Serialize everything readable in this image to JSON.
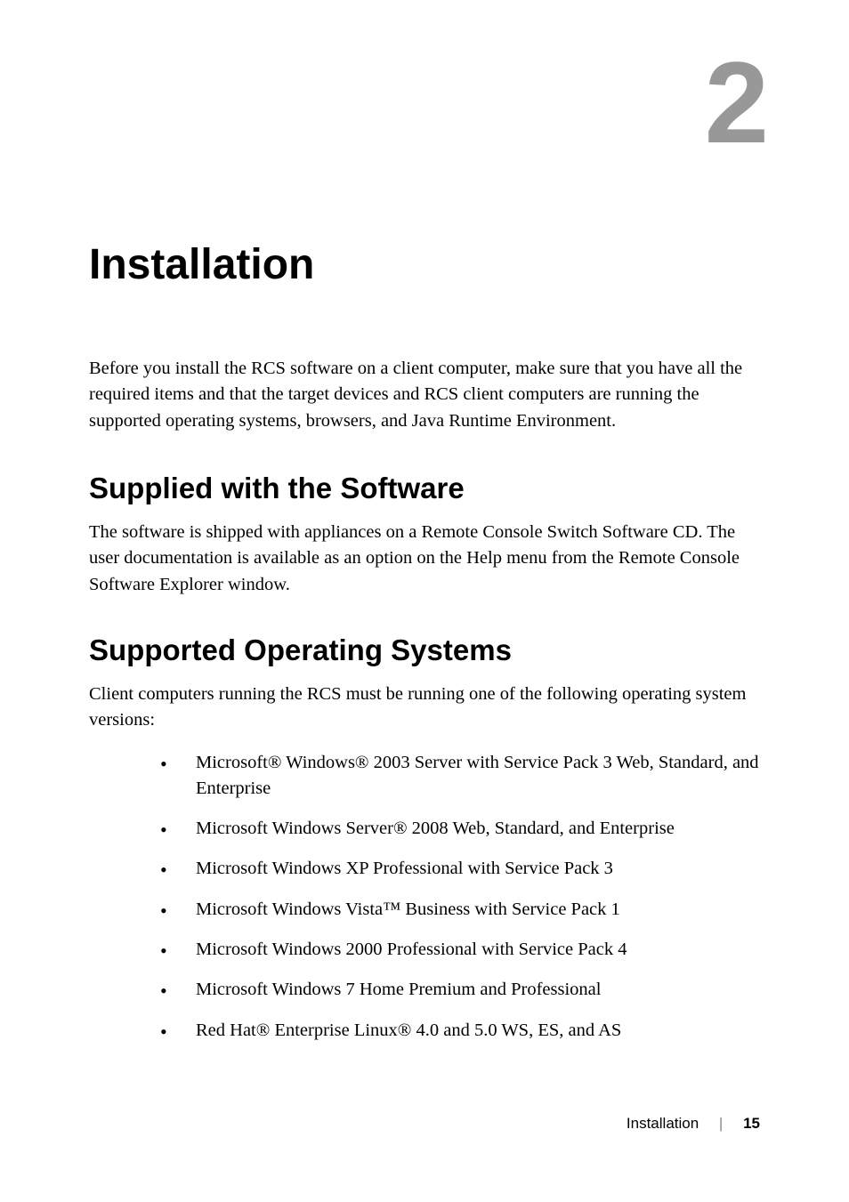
{
  "chapter": {
    "number": "2",
    "title": "Installation",
    "intro": "Before you install the RCS software on a client computer, make sure that you have all the required items and that the target devices and RCS client computers are running the supported operating systems, browsers, and Java Runtime Environment."
  },
  "sections": {
    "supplied": {
      "heading": "Supplied with the Software",
      "body": "The software is shipped with appliances on a Remote Console Switch Software CD. The user documentation is available as an option on the Help menu from the Remote Console Software Explorer window."
    },
    "supported_os": {
      "heading": "Supported Operating Systems",
      "intro": "Client computers running the RCS must be running one of the following operating system versions:",
      "items": [
        "Microsoft® Windows® 2003 Server with Service Pack 3 Web, Standard, and Enterprise",
        "Microsoft Windows Server® 2008 Web, Standard, and Enterprise",
        "Microsoft Windows XP Professional with Service Pack 3",
        "Microsoft Windows Vista™ Business with Service Pack 1",
        "Microsoft Windows 2000 Professional with Service Pack 4",
        "Microsoft Windows 7 Home Premium and Professional",
        "Red Hat® Enterprise Linux® 4.0 and 5.0 WS, ES, and AS"
      ]
    }
  },
  "footer": {
    "title": "Installation",
    "page": "15"
  }
}
